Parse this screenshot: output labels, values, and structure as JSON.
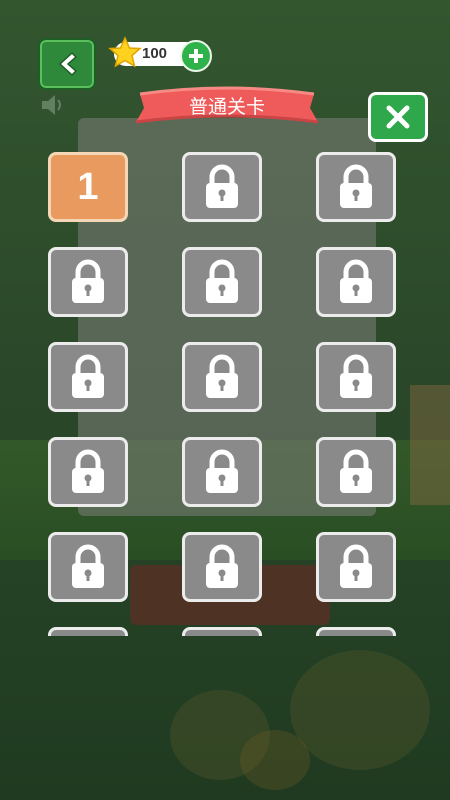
{
  "header": {
    "star_count": "100",
    "title": "普通关卡"
  },
  "levels": [
    {
      "label": "1",
      "locked": false
    },
    {
      "label": "",
      "locked": true
    },
    {
      "label": "",
      "locked": true
    },
    {
      "label": "",
      "locked": true
    },
    {
      "label": "",
      "locked": true
    },
    {
      "label": "",
      "locked": true
    },
    {
      "label": "",
      "locked": true
    },
    {
      "label": "",
      "locked": true
    },
    {
      "label": "",
      "locked": true
    },
    {
      "label": "",
      "locked": true
    },
    {
      "label": "",
      "locked": true
    },
    {
      "label": "",
      "locked": true
    },
    {
      "label": "",
      "locked": true
    },
    {
      "label": "",
      "locked": true
    },
    {
      "label": "",
      "locked": true
    },
    {
      "label": "",
      "locked": true
    },
    {
      "label": "",
      "locked": true
    },
    {
      "label": "",
      "locked": true
    }
  ],
  "colors": {
    "ribbon": "#ef5b5b",
    "unlocked_tile": "#e89a5f",
    "locked_tile": "#8a8a8a",
    "accent_green": "#2fb24a"
  },
  "icons": {
    "back": "chevron-left-icon",
    "sound": "speaker-icon",
    "star": "star-icon",
    "add": "plus-icon",
    "close": "close-icon",
    "lock": "lock-icon"
  }
}
